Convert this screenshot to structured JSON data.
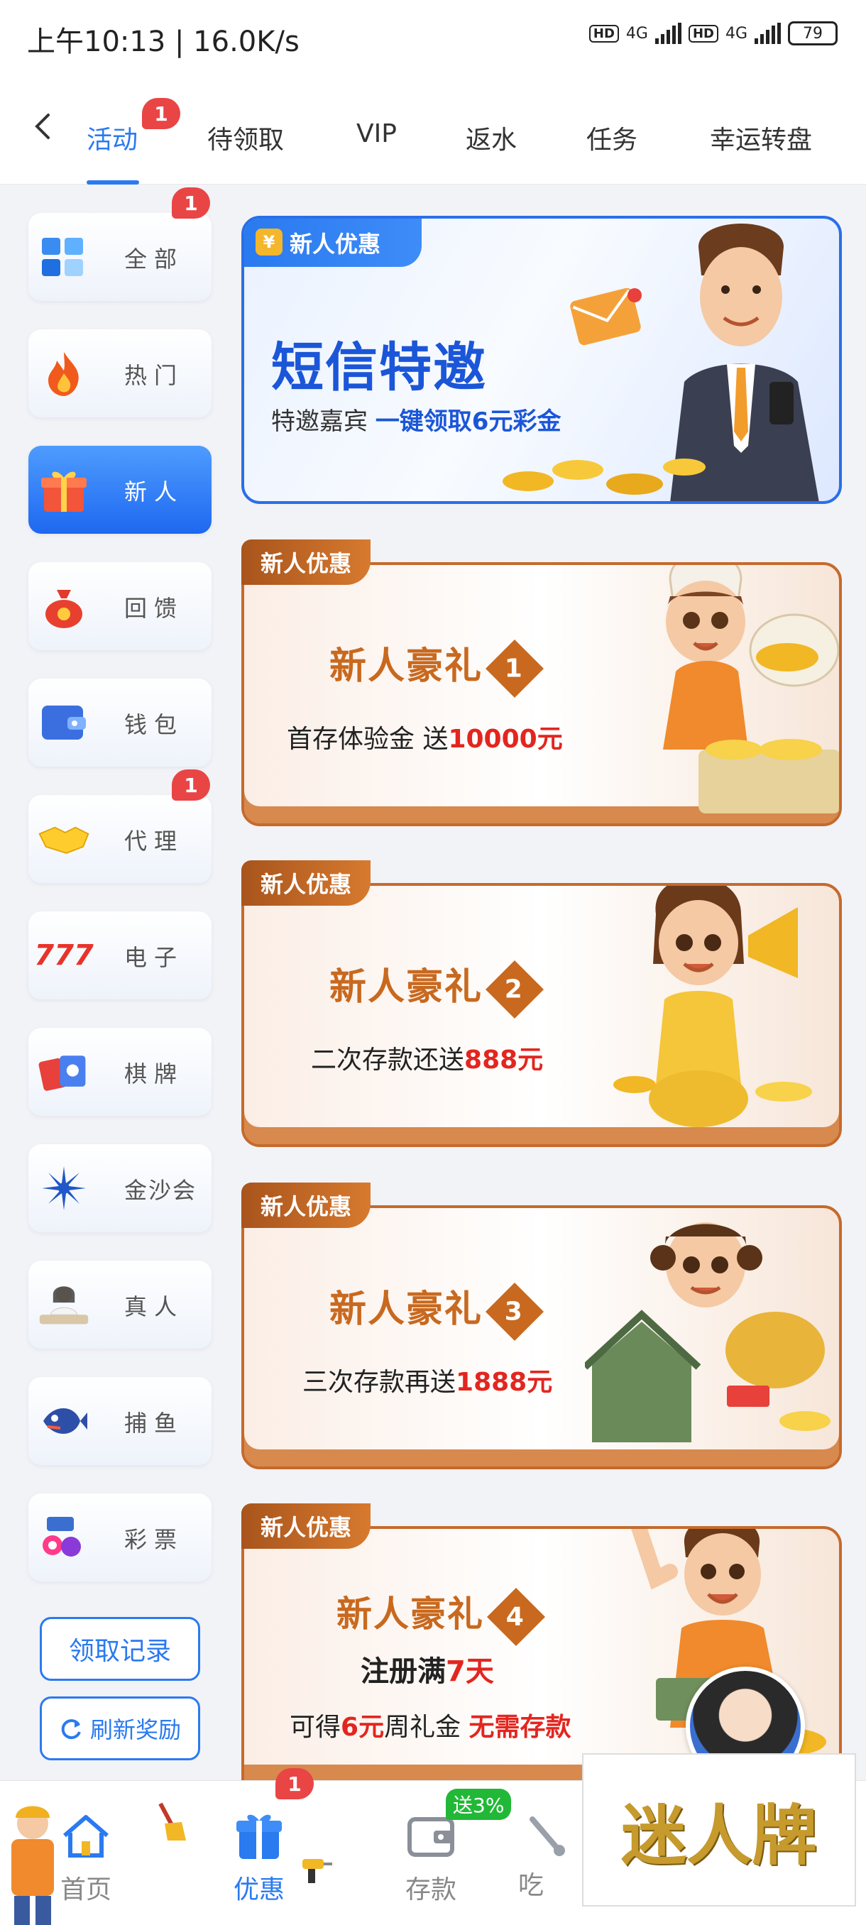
{
  "status_bar": {
    "time": "上午10:13 | 16.0K/s",
    "battery": "79",
    "hd": "HD",
    "net": "4G"
  },
  "top_tabs": [
    {
      "label": "活动",
      "active": true,
      "badge": "1"
    },
    {
      "label": "待领取"
    },
    {
      "label": "VIP"
    },
    {
      "label": "返水"
    },
    {
      "label": "任务"
    },
    {
      "label": "幸运转盘"
    }
  ],
  "sidebar": {
    "items": [
      {
        "label": "全部",
        "icon": "cubes-icon",
        "badge": "1"
      },
      {
        "label": "热门",
        "icon": "fire-icon"
      },
      {
        "label": "新人",
        "icon": "gift-icon",
        "active": true
      },
      {
        "label": "回馈",
        "icon": "money-bag-icon"
      },
      {
        "label": "钱包",
        "icon": "wallet-icon"
      },
      {
        "label": "代理",
        "icon": "handshake-icon",
        "badge": "1"
      },
      {
        "label": "电子",
        "icon": "slots-777-icon"
      },
      {
        "label": "棋牌",
        "icon": "cards-icon"
      },
      {
        "label": "金沙会",
        "icon": "sunburst-icon"
      },
      {
        "label": "真人",
        "icon": "live-dealer-icon"
      },
      {
        "label": "捕鱼",
        "icon": "fish-icon"
      },
      {
        "label": "彩票",
        "icon": "lottery-icon"
      }
    ],
    "claim_records": "领取记录",
    "refresh_rewards": "刷新奖励"
  },
  "banners": {
    "sms": {
      "tag": "新人优惠",
      "coin": "¥",
      "title": "短信特邀",
      "subtitle_plain": "特邀嘉宾",
      "subtitle_highlight": "一键领取6元彩金"
    },
    "gifts": [
      {
        "tag": "新人优惠",
        "title": "新人豪礼",
        "num": "1",
        "line_plain": "首存体验金 送",
        "line_red": "10000元"
      },
      {
        "tag": "新人优惠",
        "title": "新人豪礼",
        "num": "2",
        "line_plain": "二次存款还送",
        "line_red": "888元"
      },
      {
        "tag": "新人优惠",
        "title": "新人豪礼",
        "num": "3",
        "line_plain": "三次存款再送",
        "line_red": "1888元"
      },
      {
        "tag": "新人优惠",
        "title": "新人豪礼",
        "num": "4",
        "line_a_plain": "注册满",
        "line_a_red": "7天",
        "line_b_plain": "可得",
        "line_b_red1": "6元",
        "line_b_plain2": "周礼金",
        "line_b_red2": "无需存款"
      }
    ]
  },
  "bottom_nav": [
    {
      "label": "首页",
      "icon": "home-icon"
    },
    {
      "label": "优惠",
      "icon": "gift-box-icon",
      "active": true,
      "badge": "1"
    },
    {
      "label": "存款",
      "icon": "wallet-card-icon",
      "promo": "送3%"
    },
    {
      "label": "吃",
      "icon": "wrench-icon"
    }
  ],
  "brand": "迷人牌",
  "colors": {
    "primary": "#2a7af0",
    "badge": "#e94545",
    "orange": "#c8691f",
    "red_text": "#e2261f",
    "promo_green": "#22b837"
  }
}
